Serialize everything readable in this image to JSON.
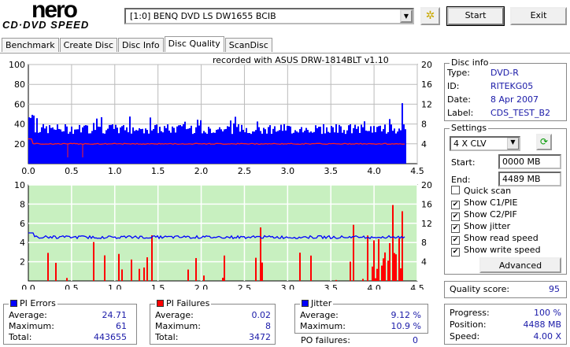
{
  "app": {
    "logo_top": "nero",
    "logo_bottom": "CD·DVD SPEED"
  },
  "toolbar": {
    "drive": "[1:0]  BENQ DVD LS DW1655 BCIB",
    "start": "Start",
    "exit": "Exit"
  },
  "tabs": [
    "Benchmark",
    "Create Disc",
    "Disc Info",
    "Disc Quality",
    "ScanDisc"
  ],
  "chart_header": "recorded with ASUS     DRW-1814BLT      v1.10",
  "disc_info": {
    "title": "Disc info",
    "type_label": "Type:",
    "type": "DVD-R",
    "id_label": "ID:",
    "id": "RITEKG05",
    "date_label": "Date:",
    "date": "8 Apr 2007",
    "label_label": "Label:",
    "label": "CDS_TEST_B2"
  },
  "settings": {
    "title": "Settings",
    "speed": "4 X CLV",
    "start_label": "Start:",
    "start": "0000 MB",
    "end_label": "End:",
    "end": "4489 MB",
    "checks": [
      {
        "label": "Quick scan",
        "checked": false
      },
      {
        "label": "Show C1/PIE",
        "checked": true
      },
      {
        "label": "Show C2/PIF",
        "checked": true
      },
      {
        "label": "Show jitter",
        "checked": true
      },
      {
        "label": "Show read speed",
        "checked": true
      },
      {
        "label": "Show write speed",
        "checked": true
      }
    ],
    "advanced": "Advanced"
  },
  "quality": {
    "label": "Quality score:",
    "value": "95"
  },
  "progress": {
    "progress_label": "Progress:",
    "progress": "100 %",
    "position_label": "Position:",
    "position": "4488 MB",
    "speed_label": "Speed:",
    "speed": "4.00 X"
  },
  "pi_errors": {
    "title": "PI Errors",
    "color": "#0000ff",
    "avg_label": "Average:",
    "avg": "24.71",
    "max_label": "Maximum:",
    "max": "61",
    "total_label": "Total:",
    "total": "443655"
  },
  "pi_failures": {
    "title": "PI Failures",
    "color": "#ff0000",
    "avg_label": "Average:",
    "avg": "0.02",
    "max_label": "Maximum:",
    "max": "8",
    "total_label": "Total:",
    "total": "3472"
  },
  "jitter": {
    "title": "Jitter",
    "color": "#0000ff",
    "avg_label": "Average:",
    "avg": "9.12 %",
    "max_label": "Maximum:",
    "max": "10.9 %",
    "po_label": "PO failures:",
    "po": "0"
  },
  "chart_data": [
    {
      "type": "bar",
      "name": "PI Errors / read speed",
      "x_range": [
        0,
        4.5
      ],
      "x_ticks": [
        "0.0",
        "0.5",
        "1.0",
        "1.5",
        "2.0",
        "2.5",
        "3.0",
        "3.5",
        "4.0",
        "4.5"
      ],
      "y_left": [
        0,
        100
      ],
      "y_left_ticks": [
        "20",
        "40",
        "60",
        "80",
        "100"
      ],
      "y_right": [
        0,
        20
      ],
      "y_right_ticks": [
        "4",
        "8",
        "12",
        "16",
        "20"
      ],
      "data_end": 4.38,
      "pie_typical": 35,
      "pie_max": 61,
      "read_speed": 4.0
    },
    {
      "type": "bar",
      "name": "PI Failures / jitter",
      "x_range": [
        0,
        4.5
      ],
      "x_ticks": [
        "0.0",
        "0.5",
        "1.0",
        "1.5",
        "2.0",
        "2.5",
        "3.0",
        "3.5",
        "4.0",
        "4.5"
      ],
      "y_left": [
        0,
        10
      ],
      "y_left_ticks": [
        "2",
        "4",
        "6",
        "8",
        "10"
      ],
      "y_right": [
        0,
        20
      ],
      "y_right_ticks": [
        "4",
        "8",
        "12",
        "16",
        "20"
      ],
      "data_end": 4.38,
      "pif_max": 8,
      "jitter_avg": 9.12
    }
  ]
}
